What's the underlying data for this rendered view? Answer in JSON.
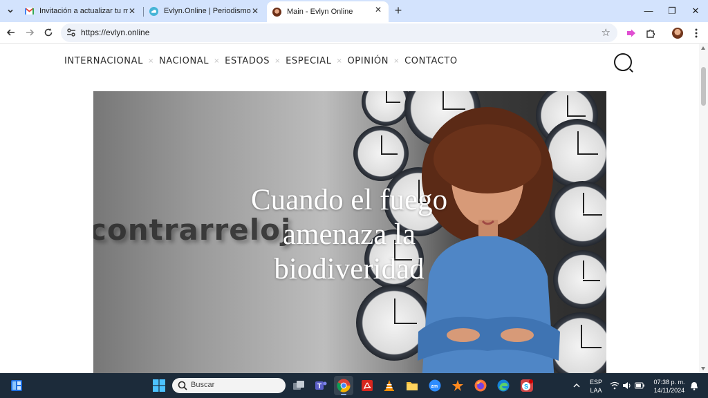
{
  "browser": {
    "tabs": [
      {
        "title": "Invitación a actualizar tu medio",
        "favicon": "gmail-icon"
      },
      {
        "title": "Evlyn.Online | Periodismo ambiental",
        "favicon": "cloud-icon"
      },
      {
        "title": "Main - Evlyn Online",
        "favicon": "avatar-icon",
        "active": true
      }
    ],
    "url": "https://evlyn.online"
  },
  "site": {
    "nav": [
      "INTERNACIONAL",
      "NACIONAL",
      "ESTADOS",
      "ESPECIAL",
      "OPINIÓN",
      "CONTACTO"
    ],
    "nav_separator": "×",
    "hero": {
      "title": "Cuando el fuego amenaza la biodiveridad",
      "background_word": "contrarreloj"
    }
  },
  "taskbar": {
    "search_placeholder": "Buscar",
    "lang": "ESP",
    "lang2": "LAA",
    "time": "07:38 p. m.",
    "date": "14/11/2024"
  },
  "colors": {
    "tabstrip": "#d3e3fd",
    "taskbar": "#1c2b3a",
    "omnibox": "#eef2f9"
  }
}
